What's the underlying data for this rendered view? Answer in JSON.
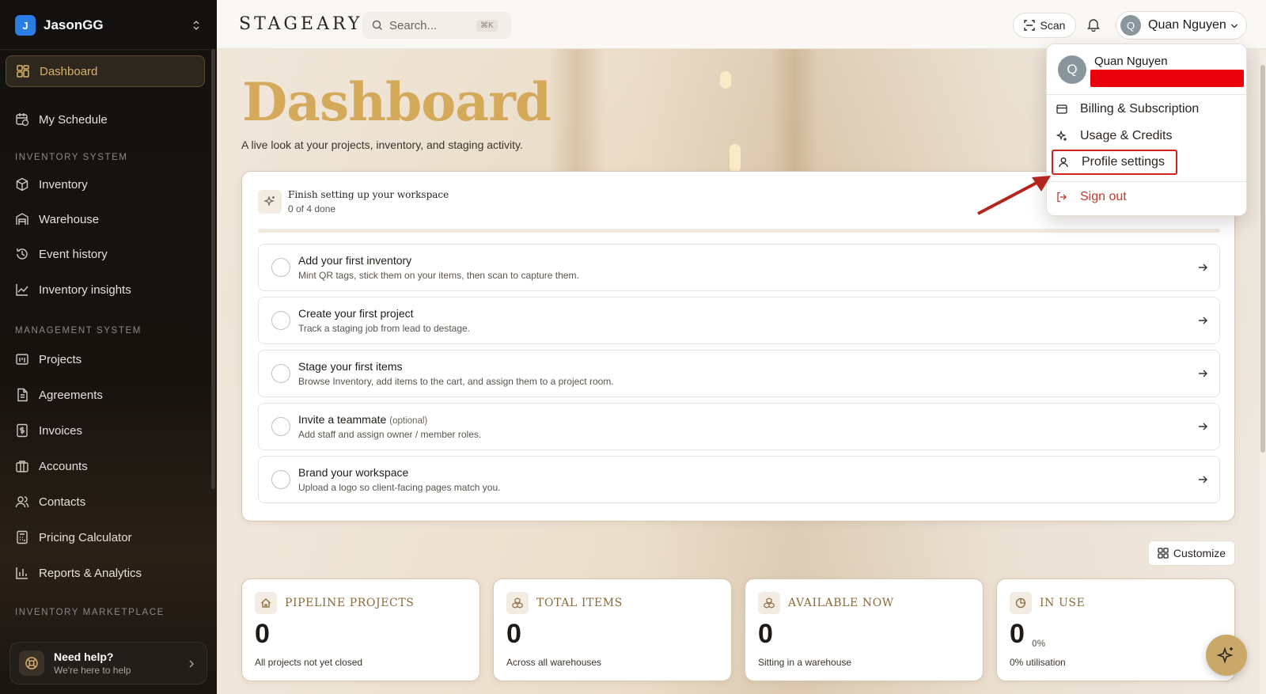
{
  "sidebar": {
    "workspace": {
      "initial": "J",
      "name": "JasonGG"
    },
    "items": [
      {
        "label": "Dashboard"
      },
      {
        "label": "My Schedule"
      },
      {
        "label": "Inventory"
      },
      {
        "label": "Warehouse"
      },
      {
        "label": "Event history"
      },
      {
        "label": "Inventory insights"
      },
      {
        "label": "Projects"
      },
      {
        "label": "Agreements"
      },
      {
        "label": "Invoices"
      },
      {
        "label": "Accounts"
      },
      {
        "label": "Contacts"
      },
      {
        "label": "Pricing Calculator"
      },
      {
        "label": "Reports & Analytics"
      }
    ],
    "sections": {
      "inventory": "INVENTORY SYSTEM",
      "management": "MANAGEMENT SYSTEM",
      "marketplace": "INVENTORY MARKETPLACE"
    },
    "help": {
      "title": "Need help?",
      "subtitle": "We're here to help"
    }
  },
  "topbar": {
    "brand": "STAGEARY",
    "search_placeholder": "Search...",
    "search_shortcut": "⌘K",
    "scan_label": "Scan",
    "user": {
      "initial": "Q",
      "name": "Quan Nguyen"
    }
  },
  "hero": {
    "title": "Dashboard",
    "subtitle": "A live look at your projects, inventory, and staging activity."
  },
  "setup": {
    "title": "Finish setting up your workspace",
    "progress_text": "0 of 4 done",
    "progress": 0,
    "tasks": [
      {
        "title": "Add your first inventory",
        "desc": "Mint QR tags, stick them on your items, then scan to capture them."
      },
      {
        "title": "Create your first project",
        "desc": "Track a staging job from lead to destage."
      },
      {
        "title": "Stage your first items",
        "desc": "Browse Inventory, add items to the cart, and assign them to a project room."
      },
      {
        "title": "Invite a teammate",
        "optional": "(optional)",
        "desc": "Add staff and assign owner / member roles."
      },
      {
        "title": "Brand your workspace",
        "desc": "Upload a logo so client-facing pages match you."
      }
    ]
  },
  "customize_label": "Customize",
  "stats": [
    {
      "label": "PIPELINE PROJECTS",
      "value": "0",
      "sub": "All projects not yet closed",
      "icon": "home-icon"
    },
    {
      "label": "TOTAL ITEMS",
      "value": "0",
      "sub": "Across all warehouses",
      "icon": "boxes-icon"
    },
    {
      "label": "AVAILABLE NOW",
      "value": "0",
      "sub": "Sitting in a warehouse",
      "icon": "boxes-icon"
    },
    {
      "label": "IN USE",
      "value": "0",
      "pct": "0%",
      "sub": "0% utilisation",
      "icon": "pie-icon"
    }
  ],
  "menu": {
    "name": "Quan Nguyen",
    "items": [
      {
        "label": "Billing & Subscription"
      },
      {
        "label": "Usage & Credits"
      },
      {
        "label": "Profile settings"
      },
      {
        "label": "Sign out"
      }
    ]
  },
  "colors": {
    "accent_gold": "#d4aa5a",
    "highlight_red": "#d61f1f",
    "sidebar_bg": "#131110",
    "workspace_blue": "#2a7de1"
  }
}
